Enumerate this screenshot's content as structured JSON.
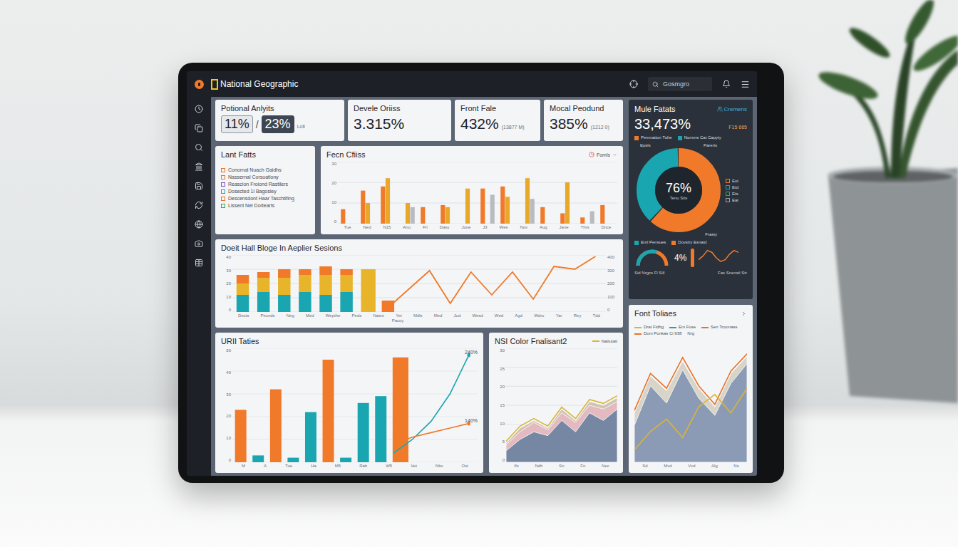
{
  "header": {
    "logo": "National Geographic",
    "search": {
      "placeholder": "Gosmgro"
    }
  },
  "kpis": [
    {
      "kind": "dual",
      "title": "Potional Anlyits",
      "values": [
        "11%",
        "23%"
      ],
      "separator": "/",
      "note": "Loti"
    },
    {
      "kind": "single",
      "title": "Devele Oriiss",
      "value": "3.315%"
    },
    {
      "kind": "single",
      "title": "Front Fale",
      "value": "432%",
      "note": "(13877 M)"
    },
    {
      "kind": "single",
      "title": "Mocal Peodund",
      "value": "385%",
      "note": "(1212 0)"
    }
  ],
  "list_card": {
    "title": "Lant Fatts",
    "items": [
      {
        "label": "Conornal Nuach Gaidhs",
        "color": "#e8732a"
      },
      {
        "label": "Nassernal Corsuationy",
        "color": "#e8732a"
      },
      {
        "label": "Reascion Froiond Rastilers",
        "color": "#7a4fc0"
      },
      {
        "label": "Dosected 1l Bagosiey",
        "color": "#1aa6b0"
      },
      {
        "label": "Descensdont Haar Taschtifing",
        "color": "#e8732a"
      },
      {
        "label": "Lissent Nel Dortearts",
        "color": "#2eaa5a"
      }
    ]
  },
  "bar_chart": {
    "title": "Fecn Cfiiss",
    "filter": "Fomls",
    "y_ticks": [
      "30",
      "20",
      "10",
      "0"
    ],
    "x_labels": [
      "Tue",
      "Ned",
      "N15",
      "Ano",
      "Fri",
      "Dasy",
      "June",
      "J3",
      "Wes",
      "Nov",
      "Aug",
      "Jane",
      "Thrs",
      "Dnce"
    ],
    "series": [
      {
        "color": "#f07a2a",
        "values": [
          7,
          16,
          18,
          0,
          8,
          9,
          0,
          17,
          18,
          0,
          8,
          5,
          3,
          9
        ]
      },
      {
        "color": "#e8a92a",
        "values": [
          0,
          10,
          22,
          10,
          0,
          8,
          17,
          0,
          13,
          22,
          0,
          20,
          0,
          0
        ]
      },
      {
        "color": "#b8bcc0",
        "values": [
          0,
          0,
          0,
          8,
          0,
          0,
          0,
          14,
          0,
          12,
          0,
          0,
          6,
          0
        ]
      }
    ]
  },
  "combo_chart": {
    "title": "Doeit Hall Bloge In Aeplier Sesions",
    "y_ticks": [
      "40",
      "30",
      "20",
      "10",
      "0"
    ],
    "y_ticks_right": [
      "400",
      "300",
      "200",
      "100",
      "0"
    ],
    "x_labels": [
      "Dects",
      "Pecnds",
      "Neg",
      "Med",
      "Wepthe",
      "Peds",
      "Nasm",
      "Yet",
      "Mdls",
      "Med",
      "Jud",
      "Wesd",
      "Wed",
      "Agd",
      "Wdro",
      "Yar",
      "Rey",
      "Tdd"
    ],
    "x_caption": "Pacoy",
    "stacks": [
      {
        "color": "#1aa6b0",
        "values": [
          12,
          14,
          12,
          14,
          12,
          14,
          0,
          0
        ]
      },
      {
        "color": "#e8b52a",
        "values": [
          8,
          10,
          12,
          12,
          14,
          12,
          30,
          0
        ]
      },
      {
        "color": "#f07a2a",
        "values": [
          6,
          4,
          6,
          4,
          6,
          4,
          0,
          8
        ]
      }
    ],
    "line": {
      "color": "#f07a2a",
      "values": [
        30,
        160,
        290,
        60,
        280,
        120,
        280,
        90,
        320,
        300,
        390
      ]
    }
  },
  "urii_chart": {
    "title": "URII Taties",
    "y_ticks": [
      "50",
      "40",
      "30",
      "20",
      "10",
      "0"
    ],
    "x_labels": [
      "M",
      "A",
      "Tue",
      "Ha",
      "M5",
      "Rah",
      "W5",
      "Vet",
      "Nbv",
      "Ost"
    ],
    "bars": [
      {
        "color": "#f07a2a",
        "values": [
          23,
          0,
          32,
          0,
          0,
          45,
          0,
          0,
          0,
          46
        ]
      },
      {
        "color": "#1aa6b0",
        "values": [
          0,
          3,
          0,
          2,
          22,
          0,
          2,
          26,
          29,
          0
        ]
      }
    ],
    "lines": [
      {
        "color": "#1aa6b0",
        "values": [
          4,
          10,
          18,
          30,
          47
        ],
        "label": "240%"
      },
      {
        "color": "#f07a2a",
        "values": [
          8,
          11,
          13,
          15,
          17
        ],
        "label": "140%"
      }
    ]
  },
  "nsi_chart": {
    "title": "NSI Color Fnalisant2",
    "legend": {
      "label": "Nattutati",
      "color": "#d9b43a"
    },
    "y_ticks": [
      "30",
      "25",
      "20",
      "15",
      "10",
      "5",
      "0"
    ],
    "x_labels": [
      "Ifs",
      "Ndh",
      "Sn",
      "Fn",
      "Nec"
    ],
    "series": [
      {
        "kind": "area",
        "color": "#cfc6b2",
        "values": [
          5,
          9,
          11,
          9,
          14,
          11,
          16,
          15,
          17
        ]
      },
      {
        "kind": "area",
        "color": "#e4b9c0",
        "values": [
          4.5,
          8,
          10.5,
          8.5,
          13,
          10.5,
          15,
          14,
          16
        ]
      },
      {
        "kind": "area",
        "color": "#7587a3",
        "values": [
          3,
          6,
          8,
          7,
          11,
          8,
          13,
          11,
          14
        ]
      },
      {
        "kind": "line",
        "color": "#d9b43a",
        "values": [
          5.5,
          9.5,
          11.5,
          9.5,
          14.5,
          11.5,
          16.5,
          15.5,
          17.5
        ]
      }
    ]
  },
  "side_panel": {
    "title": "Mule Fatats",
    "link": "Cremens",
    "value": "33,473%",
    "note": "F15 665",
    "legend": [
      {
        "label": "Pemnation Tuhe",
        "color": "#f07a2a"
      },
      {
        "label": "Nomms Cat Capyty",
        "color": "#1aa6b0"
      }
    ],
    "donut": {
      "center": "76%",
      "caption": "Tenu Stis",
      "labels": [
        "Epsls",
        "Pareris",
        "Frasty"
      ],
      "segments": [
        {
          "color": "#f07a2a",
          "value": 62
        },
        {
          "color": "#1aa6b0",
          "value": 38
        }
      ],
      "key": [
        {
          "label": "Eot",
          "color": "#f07a2a"
        },
        {
          "label": "Etd",
          "color": "#1aa6b0"
        },
        {
          "label": "Ets",
          "color": "#2eaa5a"
        },
        {
          "label": "Eat",
          "color": "#9aa0a8"
        }
      ]
    },
    "bottom_legend": [
      {
        "label": "Eml Pensues",
        "color": "#1aa6b0"
      },
      {
        "label": "Dovsiry Esnaid",
        "color": "#f07a2a"
      }
    ],
    "gauge": {
      "level": 0.6,
      "reading": "4%",
      "captions": [
        "Sid Nrgcs Fl Sill",
        "Fas Snenstl Str"
      ]
    },
    "spark": {
      "color": "#f07a2a",
      "values": [
        4,
        6,
        9,
        8,
        5,
        3,
        4,
        7,
        9,
        8
      ]
    }
  },
  "font_chart": {
    "title": "Font Toliaes",
    "legend": [
      {
        "label": "Drat Fidhg",
        "color": "#d9b43a"
      },
      {
        "label": "Em Fuse",
        "color": "#1aa6b0"
      },
      {
        "label": "Sen Tcoonass",
        "color": "#e8732a"
      },
      {
        "label": "Dom Ponkas Ci 938",
        "color": "#e8732a"
      }
    ],
    "legend_note": "Nrg",
    "x_labels": [
      "Sd",
      "Mvd",
      "Vvd",
      "Alg",
      "Ns"
    ],
    "series": [
      {
        "kind": "area",
        "color": "#d9d4c8",
        "values": [
          40,
          70,
          58,
          82,
          60,
          45,
          72,
          86
        ]
      },
      {
        "kind": "area",
        "color": "#8b9bb5",
        "values": [
          30,
          62,
          48,
          75,
          52,
          38,
          64,
          80
        ]
      },
      {
        "kind": "line",
        "color": "#e8732a",
        "values": [
          42,
          72,
          60,
          85,
          62,
          47,
          74,
          88
        ]
      },
      {
        "kind": "line",
        "color": "#d9b43a",
        "values": [
          10,
          25,
          35,
          20,
          45,
          55,
          40,
          60
        ]
      }
    ]
  }
}
